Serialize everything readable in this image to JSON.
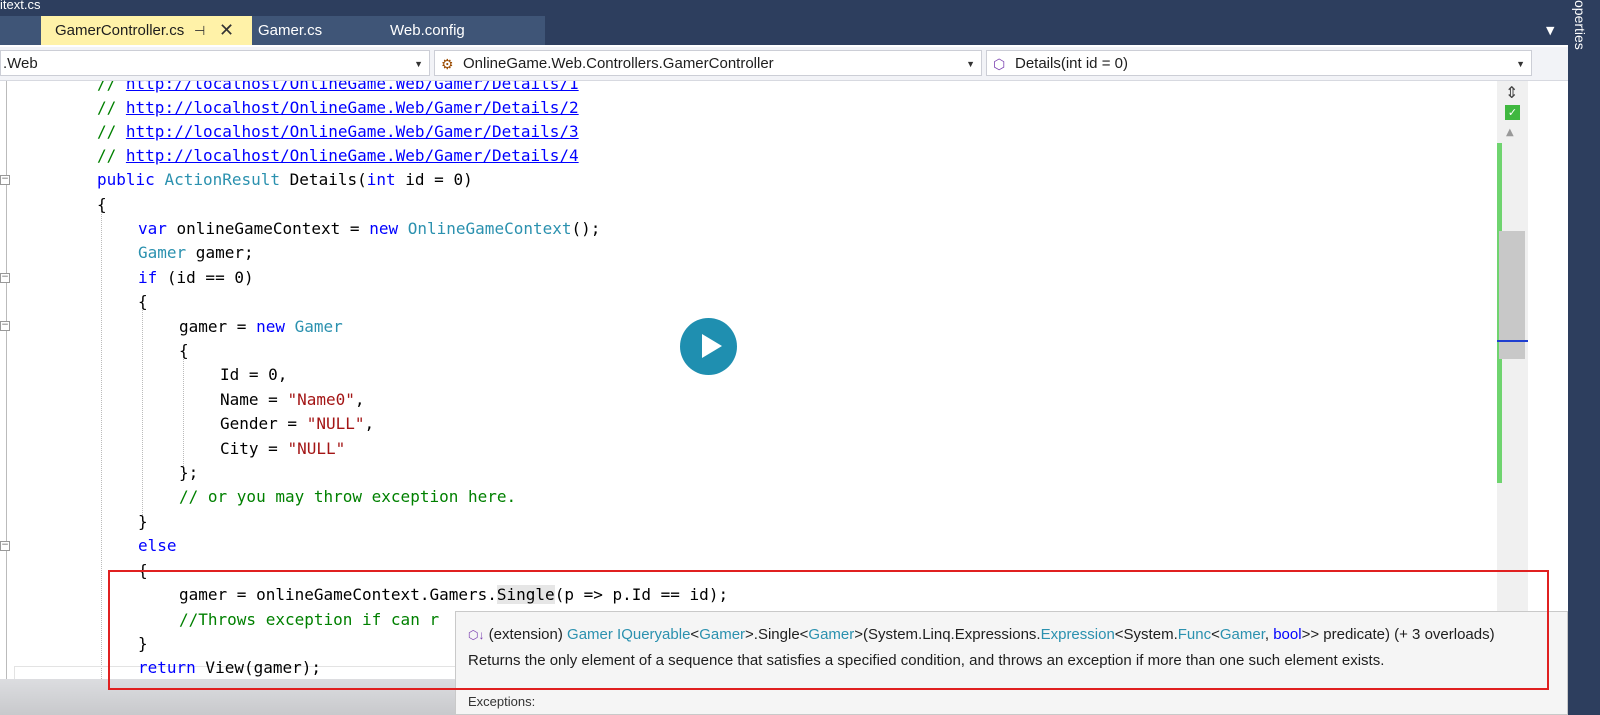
{
  "window": {
    "prev_tab_fragment": "itext.cs",
    "tabs": [
      {
        "label": "GamerController.cs",
        "active": true,
        "pin": "⊣",
        "close": "✕"
      },
      {
        "label": "Gamer.cs",
        "active": false
      },
      {
        "label": "Web.config",
        "active": false
      }
    ],
    "side_panel_label": "operties"
  },
  "navbar": {
    "project": ".Web",
    "class": "OnlineGame.Web.Controllers.GamerController",
    "member": "Details(int id = 0)"
  },
  "code": {
    "comment_links": [
      "http://localhost/OnlineGame.Web/Gamer/Details/1",
      "http://localhost/OnlineGame.Web/Gamer/Details/2",
      "http://localhost/OnlineGame.Web/Gamer/Details/3",
      "http://localhost/OnlineGame.Web/Gamer/Details/4"
    ],
    "comment_prefix": "// ",
    "sig": {
      "kw_public": "public ",
      "type": "ActionResult",
      "name": " Details(",
      "kw_int": "int",
      "rest": " id = 0)"
    },
    "brace_open": "{",
    "brace_close": "}",
    "l_var": {
      "kw": "var",
      "a": " onlineGameContext = ",
      "kw_new": "new",
      "type": " OnlineGameContext",
      "b": "();"
    },
    "l_decl": {
      "type": "Gamer",
      "a": " gamer;"
    },
    "l_if": {
      "kw": "if",
      "a": " (id == 0)"
    },
    "l_newgamer": {
      "a": "gamer = ",
      "kw_new": "new",
      "type": " Gamer"
    },
    "l_id": "Id = 0,",
    "l_name": {
      "a": "Name = ",
      "s": "\"Name0\"",
      "b": ","
    },
    "l_gender": {
      "a": "Gender = ",
      "s": "\"NULL\"",
      "b": ","
    },
    "l_city": {
      "a": "City = ",
      "s": "\"NULL\""
    },
    "l_close_init": "};",
    "l_comment1": "// or you may throw exception here.",
    "l_else": "else",
    "l_single": {
      "a": "gamer = onlineGameContext.Gamers.",
      "hl": "Single",
      "b": "(p => p.Id == id);"
    },
    "l_comment2": "//Throws exception if can r",
    "l_return": {
      "kw": "return",
      "a": " View(gamer);"
    }
  },
  "tooltip": {
    "icon": "⬡↓",
    "prefix": " (extension) ",
    "t1": "Gamer",
    "t2": " IQueryable",
    "p1": "<",
    "t3": "Gamer",
    "p2": ">.Single<",
    "t4": "Gamer",
    "p3": ">(System.Linq.Expressions.",
    "t5": "Expression",
    "p4": "<System.",
    "t6": "Func",
    "p5": "<",
    "t7": "Gamer",
    "p6": ", ",
    "k1": "bool",
    "p7": ">> predicate) (+ 3 overloads)",
    "description": "Returns the only element of a sequence that satisfies a specified condition, and throws an exception if more than one such element exists.",
    "more": "Exceptions:"
  },
  "colors": {
    "keyword": "#0000ff",
    "type": "#2b91af",
    "string": "#a31515",
    "comment": "#008000",
    "highlight_box": "#e02020"
  }
}
